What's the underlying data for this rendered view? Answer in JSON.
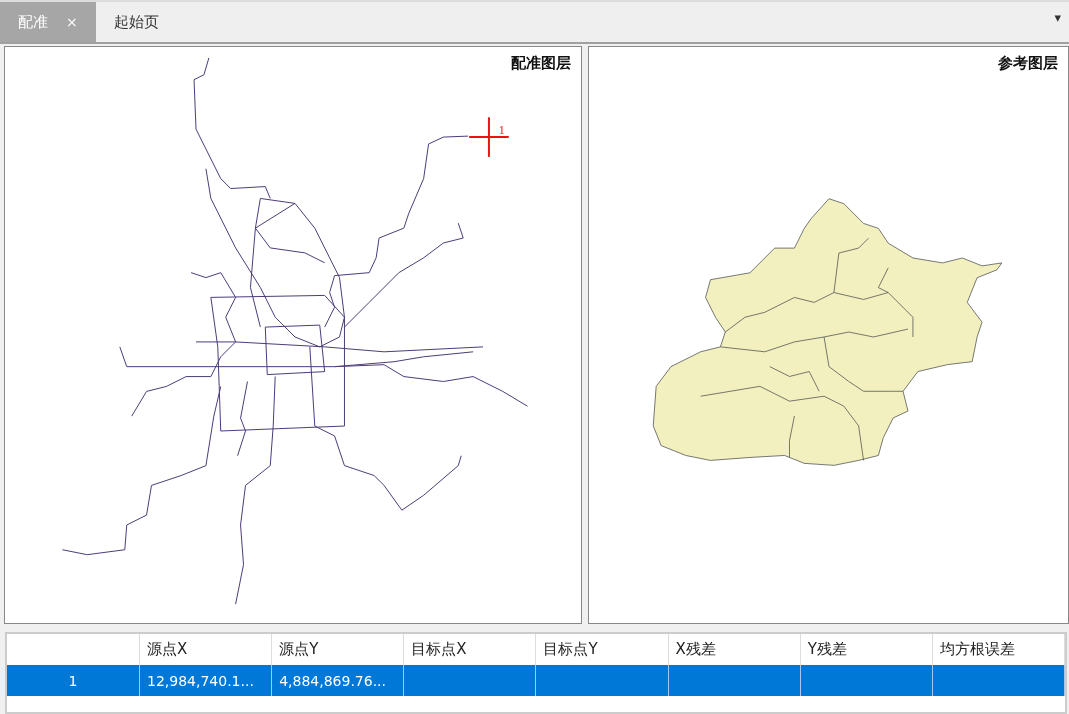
{
  "tabs": [
    {
      "label": "配准",
      "selected": true,
      "close_glyph": "×"
    },
    {
      "label": "起始页",
      "selected": false
    }
  ],
  "tab_menu_glyph": "▾",
  "panels": [
    {
      "kind": "source",
      "title": "配准图层",
      "marker_label": "1"
    },
    {
      "kind": "reference",
      "title": "参考图层"
    }
  ],
  "table": {
    "columns": [
      "",
      "源点X",
      "源点Y",
      "目标点X",
      "目标点Y",
      "X残差",
      "Y残差",
      "均方根误差"
    ],
    "rows": [
      {
        "selected": true,
        "cells": [
          "1",
          "12,984,740.1...",
          "4,884,869.76...",
          "",
          "",
          "",
          "",
          ""
        ]
      }
    ]
  }
}
